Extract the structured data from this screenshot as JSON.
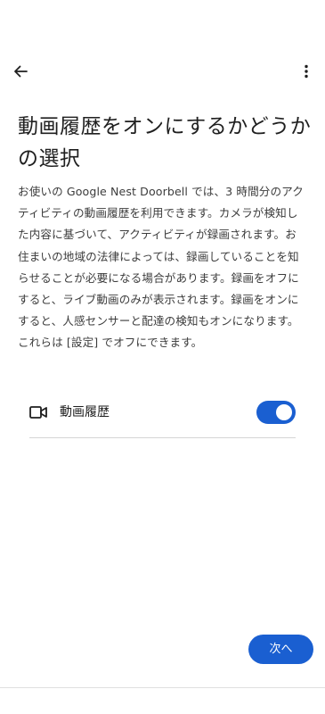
{
  "header": {
    "back_icon": "arrow-back-icon",
    "more_icon": "more-vert-icon"
  },
  "title": "動画履歴をオンにするかどうかの選択",
  "description": "お使いの Google Nest Doorbell では、3 時間分のアクティビティの動画履歴を利用できます。カメラが検知した内容に基づいて、アクティビティが録画されます。お住まいの地域の法律によっては、録画していることを知らせることが必要になる場合があります。録画をオフにすると、ライブ動画のみが表示されます。録画をオンにすると、人感センサーと配達の検知もオンになります。これらは [設定] でオフにできます。",
  "setting": {
    "icon": "videocam-icon",
    "label": "動画履歴",
    "enabled": true
  },
  "footer": {
    "next_label": "次へ"
  },
  "colors": {
    "accent": "#1a5fd1",
    "text_primary": "#1f1f1f",
    "text_secondary": "#3c3c3c",
    "divider": "#d5d5d5"
  }
}
